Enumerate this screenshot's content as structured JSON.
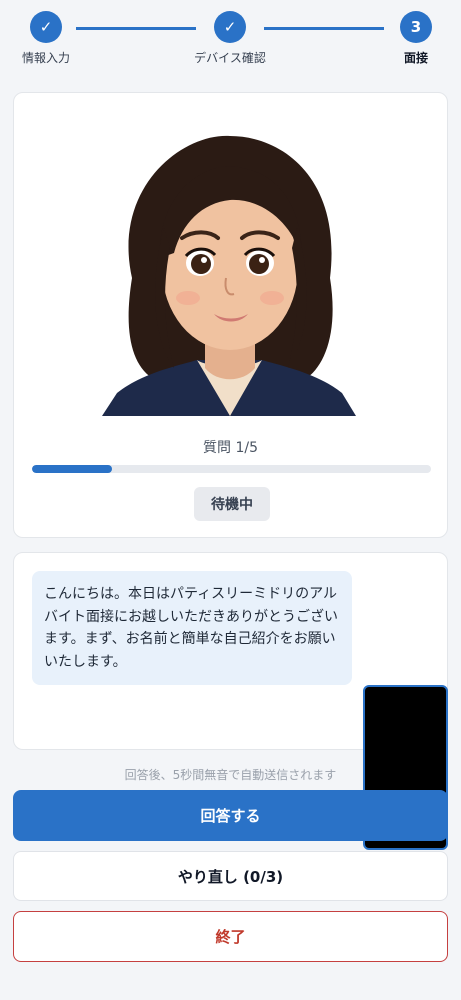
{
  "stepper": {
    "steps": [
      {
        "label": "情報入力",
        "state": "done",
        "icon": "check-icon"
      },
      {
        "label": "デバイス確認",
        "state": "done",
        "icon": "check-icon"
      },
      {
        "label": "面接",
        "state": "active",
        "number": "3"
      }
    ],
    "check_glyph": "✓"
  },
  "interview": {
    "question_label": "質問 1/5",
    "progress": 0.2,
    "status": "待機中"
  },
  "chat": {
    "message": "こんにちは。本日はパティスリーミドリのアルバイト面接にお越しいただきありがとうございます。まず、お名前と簡単な自己紹介をお願いいたします。"
  },
  "hint": "回答後、5秒間無音で自動送信されます",
  "buttons": {
    "answer": "回答する",
    "retry": "やり直し (0/3)",
    "end": "終了"
  },
  "colors": {
    "accent": "#2a72c7",
    "danger": "#c54040",
    "bubble": "#e8f1fb"
  }
}
